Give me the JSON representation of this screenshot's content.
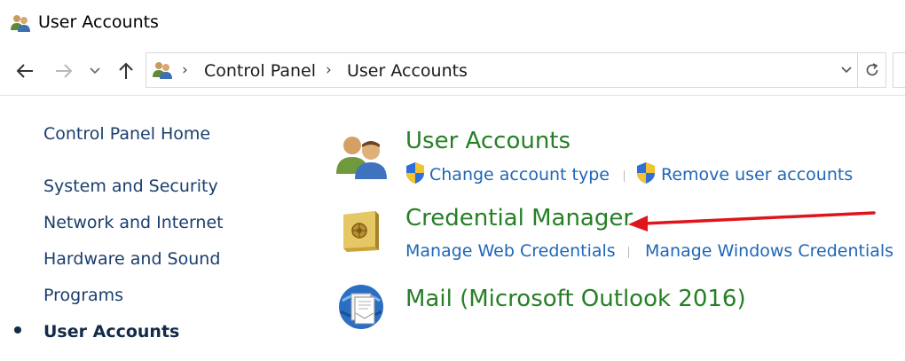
{
  "window": {
    "title": "User Accounts"
  },
  "address_bar": {
    "crumbs": [
      "Control Panel",
      "User Accounts"
    ]
  },
  "sidebar": {
    "items": [
      {
        "label": "Control Panel Home",
        "active": false
      },
      {
        "label": "System and Security",
        "active": false
      },
      {
        "label": "Network and Internet",
        "active": false
      },
      {
        "label": "Hardware and Sound",
        "active": false
      },
      {
        "label": "Programs",
        "active": false
      },
      {
        "label": "User Accounts",
        "active": true
      }
    ]
  },
  "categories": [
    {
      "title": "User Accounts",
      "icon": "users-icon",
      "links": [
        "Change account type",
        "Remove user accounts"
      ]
    },
    {
      "title": "Credential Manager",
      "icon": "vault-icon",
      "links": [
        "Manage Web Credentials",
        "Manage Windows Credentials"
      ]
    },
    {
      "title": "Mail (Microsoft Outlook 2016)",
      "icon": "mail-icon",
      "links": []
    }
  ],
  "colors": {
    "category_title": "#267f26",
    "task_link": "#1f66b7",
    "sidebar_link": "#1a3e6e",
    "annotation_arrow": "#e0141b"
  }
}
